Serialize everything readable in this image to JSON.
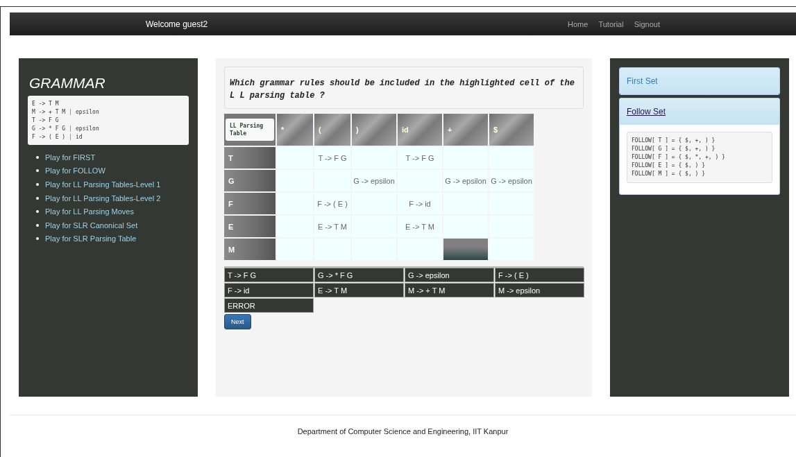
{
  "navbar": {
    "welcome": "Welcome guest2",
    "links": [
      "Home",
      "Tutorial",
      "Signout"
    ]
  },
  "sidebar": {
    "title": "GRAMMAR",
    "grammar": [
      [
        {
          "text": "E -> T M",
          "kind": "rule"
        }
      ],
      [
        {
          "text": "M -> + T M",
          "kind": "rule"
        },
        {
          "text": "|",
          "kind": "separator"
        },
        {
          "text": "epsilon",
          "kind": "rule"
        }
      ],
      [
        {
          "text": "T -> F G",
          "kind": "rule"
        }
      ],
      [
        {
          "text": "G -> * F G",
          "kind": "rule"
        },
        {
          "text": "|",
          "kind": "separator"
        },
        {
          "text": "epsilon",
          "kind": "rule"
        }
      ],
      [
        {
          "text": "F -> ( E )",
          "kind": "rule"
        },
        {
          "text": "|",
          "kind": "separator"
        },
        {
          "text": "id",
          "kind": "rule"
        }
      ]
    ],
    "items": [
      "Play for FIRST",
      "Play for FOLLOW",
      "Play for LL Parsing Tables-Level 1",
      "Play for LL Parsing Tables-Level 2",
      "Play for LL Parsing Moves",
      "Play for SLR Canonical Set",
      "Play for SLR Parsing Table"
    ]
  },
  "question": "Which grammar rules should be included in the highlighted cell of the L L parsing table ?",
  "table": {
    "corner": "LL Parsing Table",
    "columns": [
      "*",
      "(",
      ")",
      "id",
      "+",
      "$"
    ],
    "rows": [
      {
        "head": "T",
        "cells": [
          {
            "text": "",
            "highlighted": false
          },
          {
            "text": "T -> F G",
            "highlighted": false
          },
          {
            "text": "",
            "highlighted": false
          },
          {
            "text": "T -> F G",
            "highlighted": false
          },
          {
            "text": "",
            "highlighted": false
          },
          {
            "text": "",
            "highlighted": false
          }
        ]
      },
      {
        "head": "G",
        "cells": [
          {
            "text": "",
            "highlighted": false
          },
          {
            "text": "",
            "highlighted": false
          },
          {
            "text": "G -> epsilon",
            "highlighted": false
          },
          {
            "text": "",
            "highlighted": false
          },
          {
            "text": "G -> epsilon",
            "highlighted": false
          },
          {
            "text": "G -> epsilon",
            "highlighted": false
          }
        ]
      },
      {
        "head": "F",
        "cells": [
          {
            "text": "",
            "highlighted": false
          },
          {
            "text": "F -> ( E )",
            "highlighted": false
          },
          {
            "text": "",
            "highlighted": false
          },
          {
            "text": "F -> id",
            "highlighted": false
          },
          {
            "text": "",
            "highlighted": false
          },
          {
            "text": "",
            "highlighted": false
          }
        ]
      },
      {
        "head": "E",
        "cells": [
          {
            "text": "",
            "highlighted": false
          },
          {
            "text": "E -> T M",
            "highlighted": false
          },
          {
            "text": "",
            "highlighted": false
          },
          {
            "text": "E -> T M",
            "highlighted": false
          },
          {
            "text": "",
            "highlighted": false
          },
          {
            "text": "",
            "highlighted": false
          }
        ]
      },
      {
        "head": "M",
        "cells": [
          {
            "text": "",
            "highlighted": false
          },
          {
            "text": "",
            "highlighted": false
          },
          {
            "text": "",
            "highlighted": false
          },
          {
            "text": "",
            "highlighted": false
          },
          {
            "text": "",
            "highlighted": true
          },
          {
            "text": "",
            "highlighted": false
          }
        ]
      }
    ]
  },
  "options": [
    "T -> F G",
    "G -> * F G",
    "G -> epsilon",
    "F -> ( E )",
    "F -> id",
    "E -> T M",
    "M -> + T M",
    "M -> epsilon",
    "ERROR"
  ],
  "next_button": "Next",
  "panels": [
    {
      "title": "First Set",
      "expanded": false
    },
    {
      "title": "Follow Set",
      "expanded": true,
      "lines": [
        "FOLLOW[ T ] = { $, +, ) }",
        "FOLLOW[ G ] = { $, +, ) }",
        "FOLLOW[ F ] = { $, *, +, ) }",
        "FOLLOW[ E ] = { $, ) }",
        "FOLLOW[ M ] = { $, ) }"
      ]
    }
  ],
  "footer": "Department of Computer Science and Engineering, IIT Kanpur"
}
